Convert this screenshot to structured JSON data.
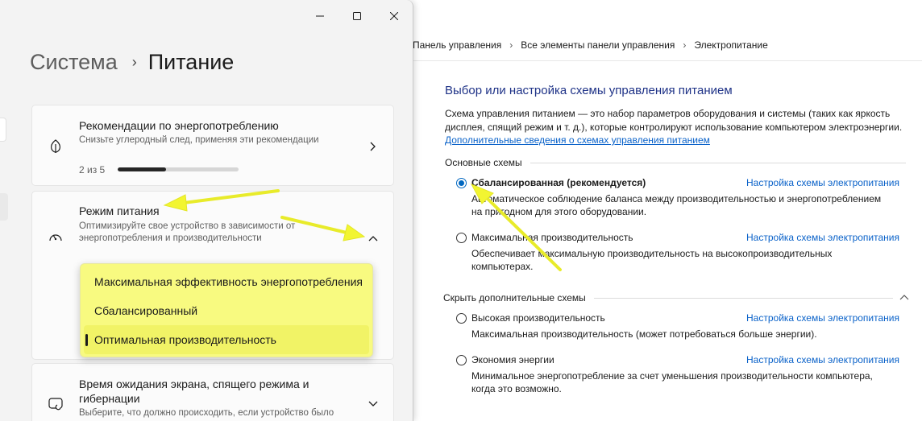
{
  "control_panel": {
    "breadcrumb": [
      "Панель управления",
      "Все элементы панели управления",
      "Электропитание"
    ],
    "heading": "Выбор или настройка схемы управления питанием",
    "description": "Схема управления питанием — это набор параметров оборудования и системы (таких как яркость дисплея, спящий режим и т. д.), которые контролируют использование компьютером электроэнергии.",
    "details_link": "Дополнительные сведения о схемах управления питанием",
    "main_section": "Основные схемы",
    "hidden_section": "Скрыть дополнительные схемы",
    "plans": [
      {
        "name": "Сбалансированная (рекомендуется)",
        "link": "Настройка схемы электропитания",
        "desc": "Автоматическое соблюдение баланса между производительностью и энергопотреблением на пригодном для этого оборудовании.",
        "checked": true
      },
      {
        "name": "Максимальная производительность",
        "link": "Настройка схемы электропитания",
        "desc": "Обеспечивает максимальную производительность на высокопроизводительных компьютерах.",
        "checked": false
      }
    ],
    "extra_plans": [
      {
        "name": "Высокая производительность",
        "link": "Настройка схемы электропитания",
        "desc": "Максимальная производительность (может потребоваться больше энергии).",
        "checked": false
      },
      {
        "name": "Экономия энергии",
        "link": "Настройка схемы электропитания",
        "desc": "Минимальное энергопотребление за счет уменьшения производительности компьютера, когда это возможно.",
        "checked": false
      }
    ]
  },
  "settings": {
    "title_parent": "Система",
    "title_current": "Питание",
    "recommendations": {
      "title": "Рекомендации по энергопотреблению",
      "subtitle": "Снизьте углеродный след, применяя эти рекомендации",
      "progress_label": "2 из 5",
      "progress": 0.4
    },
    "power_mode": {
      "title": "Режим питания",
      "subtitle_line1": "Оптимизируйте свое устройство в зависимости от",
      "subtitle_line2": "энергопотребления и производительности",
      "options": [
        "Максимальная эффективность энергопотребления",
        "Сбалансированный",
        "Оптимальная производительность"
      ],
      "selected_index": 2
    },
    "screen_sleep": {
      "title_line1": "Время ожидания экрана, спящего режима и",
      "title_line2": "гибернации",
      "subtitle": "Выберите, что должно происходить, если устройство было"
    }
  },
  "colors": {
    "highlight": "#f8fa80",
    "arrow": "#f2f531",
    "link": "#0a62c9",
    "heading": "#1e3287"
  },
  "icons": {
    "leaf": "leaf-icon",
    "gauge": "gauge-icon",
    "screen": "screen-sleep-icon",
    "minimize": "minimize-icon",
    "maximize": "maximize-icon",
    "close": "close-icon"
  }
}
